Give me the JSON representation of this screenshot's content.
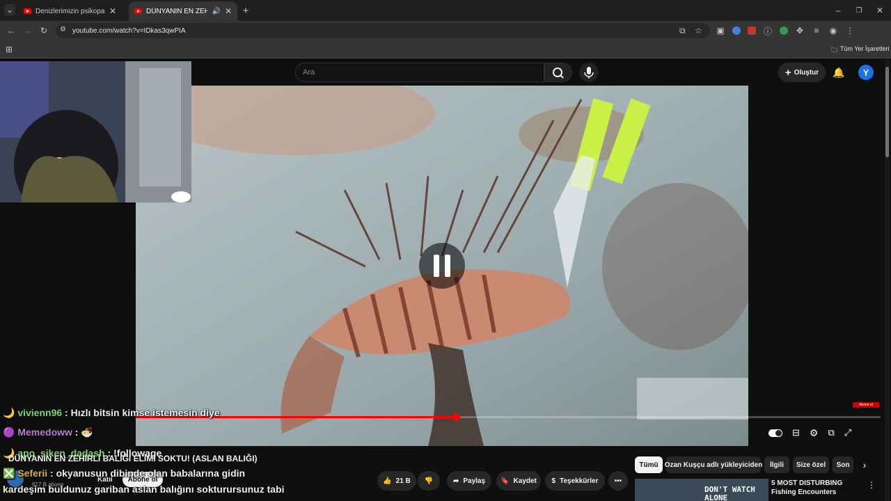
{
  "browser": {
    "tabs": [
      {
        "title": "Denizlerimizin psikopatı... - You"
      },
      {
        "title": "DÜNYANIN EN ZEHİRLİ BA"
      }
    ],
    "url": "youtube.com/watch?v=IDkas3qwPIA",
    "bookmarks_label": "Tüm Yer İşaretleri"
  },
  "youtube": {
    "search_placeholder": "Ara",
    "create_label": "Oluştur",
    "avatar_letter": "Y",
    "video_title": "DÜNYANIN EN ZEHİRLİ BALIĞI ELİMİ SOKTU! (ASLAN BALIĞI)",
    "progress_fraction": 0.43,
    "channel": {
      "name": "Ozan Kuşçu",
      "subscribers": "817 B abone",
      "join_label": "Katıl",
      "subscribe_label": "Abone ol"
    },
    "actions": {
      "likes": "21 B",
      "share": "Paylaş",
      "save": "Kaydet",
      "thanks": "Teşekkürler"
    },
    "chips": [
      "Tümü",
      "Ozan Kuşçu adlı yükleyiciden",
      "İlgili",
      "Size özel",
      "Son"
    ],
    "recommendation": {
      "title": "5 MOST DISTURBING Fishing Encounters",
      "thumb_text": "DON'T WATCH ALONE"
    },
    "badge_text": "Abone ol"
  },
  "chat": [
    {
      "user": "vivienn96",
      "message": ": Hızlı bitsin kimse istemesin diye"
    },
    {
      "user": "Memedoww",
      "message": ":"
    },
    {
      "user": "apo_siken_dadash",
      "message": ": !followage"
    },
    {
      "user": "Seferii",
      "message": ": okyanusun dibinde olan babalarına gidin"
    },
    {
      "user": "",
      "message": "kardeşim buldunuz gariban aslan balığını sokturursunuz tabi"
    }
  ],
  "colors": {
    "accent_red": "#ff0000",
    "chat_user": "#7cd76b"
  }
}
